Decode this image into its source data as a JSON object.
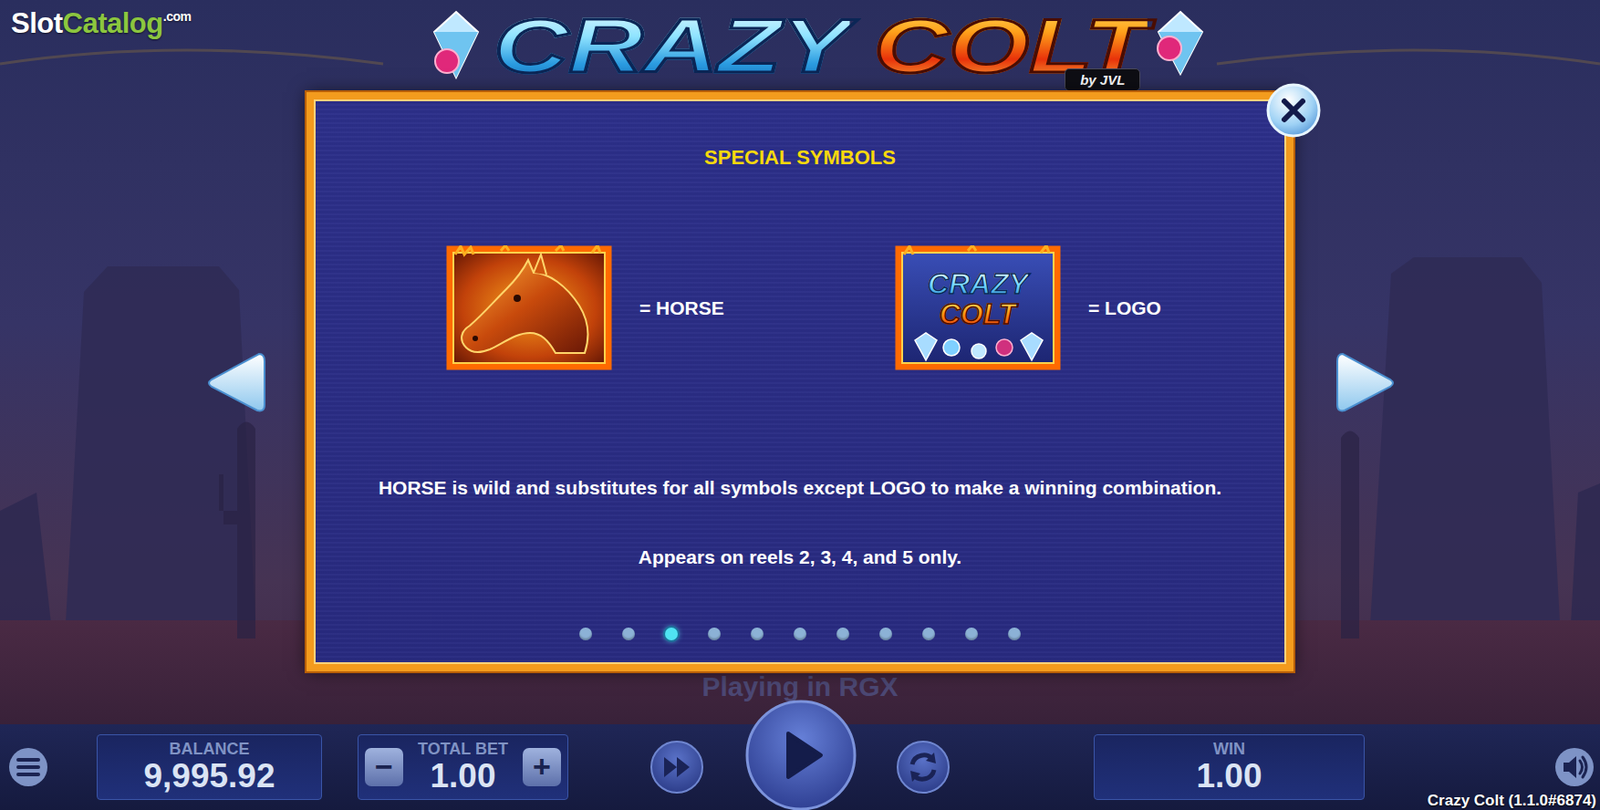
{
  "watermark": {
    "part1": "Slot",
    "part2": "Catalog",
    "suffix": ".com"
  },
  "game_logo": {
    "word1": "CRAZY",
    "word2": "COLT",
    "badge": "by JVL"
  },
  "dialog": {
    "title": "SPECIAL SYMBOLS",
    "symbols": [
      {
        "kind": "horse",
        "label": "= HORSE"
      },
      {
        "kind": "logo",
        "label": "= LOGO",
        "art": [
          "CRAZY",
          "COLT"
        ]
      }
    ],
    "rules": [
      "HORSE is wild and substitutes for all symbols except LOGO to make a winning combination.",
      "Appears on reels 2, 3, 4, and 5 only."
    ],
    "pages": [
      {
        "selected": false
      },
      {
        "selected": false
      },
      {
        "selected": true
      },
      {
        "selected": false
      },
      {
        "selected": false
      },
      {
        "selected": false
      },
      {
        "selected": false
      },
      {
        "selected": false
      },
      {
        "selected": false
      },
      {
        "selected": false
      },
      {
        "selected": false
      }
    ]
  },
  "backdrop_text": "Playing in RGX",
  "controls": {
    "balance": {
      "label": "BALANCE",
      "value": "9,995.92"
    },
    "total_bet": {
      "label": "TOTAL BET",
      "value": "1.00",
      "minus": "−",
      "plus": "+"
    },
    "win": {
      "label": "WIN",
      "value": "1.00"
    }
  },
  "version": "Crazy Colt (1.1.0#6874)"
}
